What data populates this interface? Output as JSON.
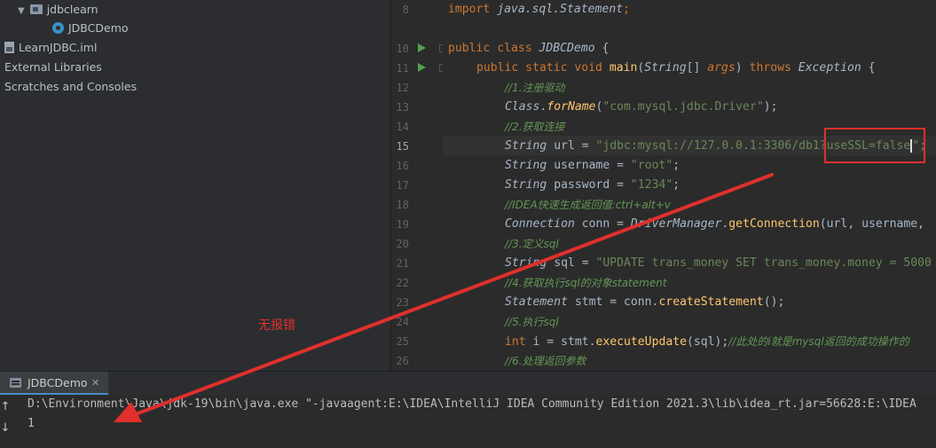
{
  "project": {
    "items": [
      {
        "label": "jdbclearn",
        "kind": "folder"
      },
      {
        "label": "JDBCDemo",
        "kind": "class"
      },
      {
        "label": "LearnJDBC.iml",
        "kind": "file"
      },
      {
        "label": "External Libraries",
        "kind": "libraries"
      },
      {
        "label": "Scratches and Consoles",
        "kind": "scratches"
      }
    ]
  },
  "editor": {
    "line_numbers": [
      "8",
      "10",
      "11",
      "12",
      "13",
      "14",
      "15",
      "16",
      "17",
      "18",
      "19",
      "20",
      "21",
      "22",
      "23",
      "24",
      "25",
      "26"
    ],
    "lines": {
      "l8": {
        "import": "import",
        "path": "java.sql.Statement",
        "semi": ";"
      },
      "l10": {
        "public": "public",
        "class": "class",
        "name": "JDBCDemo",
        "brace": " {"
      },
      "l11": {
        "public": "public",
        "static": "static",
        "void": "void",
        "main": "main",
        "p1": "(",
        "string": "String",
        "arr": "[] ",
        "args": "args",
        "p2": ") ",
        "throws": "throws",
        "exc": "Exception",
        "brace": " {"
      },
      "l12": "//1.注册驱动",
      "l13": {
        "class": "Class",
        "dot": ".",
        "forName": "forName",
        "p1": "(",
        "str": "\"com.mysql.jdbc.Driver\"",
        "p2": ");"
      },
      "l14": "//2.获取连接",
      "l15": {
        "type": "String",
        "rest": " url = ",
        "str": "\"jdbc:mysql://127.0.0.1:3306/db1?useSSL=false",
        "end": "\";"
      },
      "l16": {
        "type": "String",
        "rest": " username = ",
        "str": "\"root\"",
        "semi": ";"
      },
      "l17": {
        "type": "String",
        "rest": " password = ",
        "str": "\"1234\"",
        "semi": ";"
      },
      "l18": "//IDEA快速生成返回值:ctrl+alt+v",
      "l19": {
        "type": "Connection",
        "rest": " conn = ",
        "cls": "DriverManager",
        "dot": ".",
        "fn": "getConnection",
        "args": "(url, username,"
      },
      "l20": "//3.定义sql",
      "l21": {
        "type": "String",
        "rest": " sql = ",
        "str": "\"UPDATE trans_money SET trans_money.money = 5000"
      },
      "l22": "//4.获取执行sql的对象statement",
      "l23": {
        "type": "Statement",
        "rest": " stmt = conn.",
        "fn": "createStatement",
        "end": "();"
      },
      "l24": "//5.执行sql",
      "l25": {
        "kw": "int",
        "rest": " i = stmt.",
        "fn": "executeUpdate",
        "args": "(sql);",
        "cm": "//此处的i就是mysql返回的成功操作的"
      },
      "l26": "//6.处理返回参数"
    }
  },
  "annotation": {
    "note": "无报错"
  },
  "run": {
    "tab_label": "JDBCDemo",
    "tab_close": "✕",
    "console_lines": [
      "D:\\Environment\\Java\\jdk-19\\bin\\java.exe \"-javaagent:E:\\IDEA\\IntelliJ IDEA Community Edition 2021.3\\lib\\idea_rt.jar=56628:E:\\IDEA",
      "1"
    ],
    "up_arrow": "↑",
    "down_arrow": "↓"
  },
  "colors": {
    "accent_red": "#e0302c",
    "keyword": "#cc7832",
    "string": "#6a8759",
    "comment": "#629755",
    "run_green": "#4ea34d"
  }
}
